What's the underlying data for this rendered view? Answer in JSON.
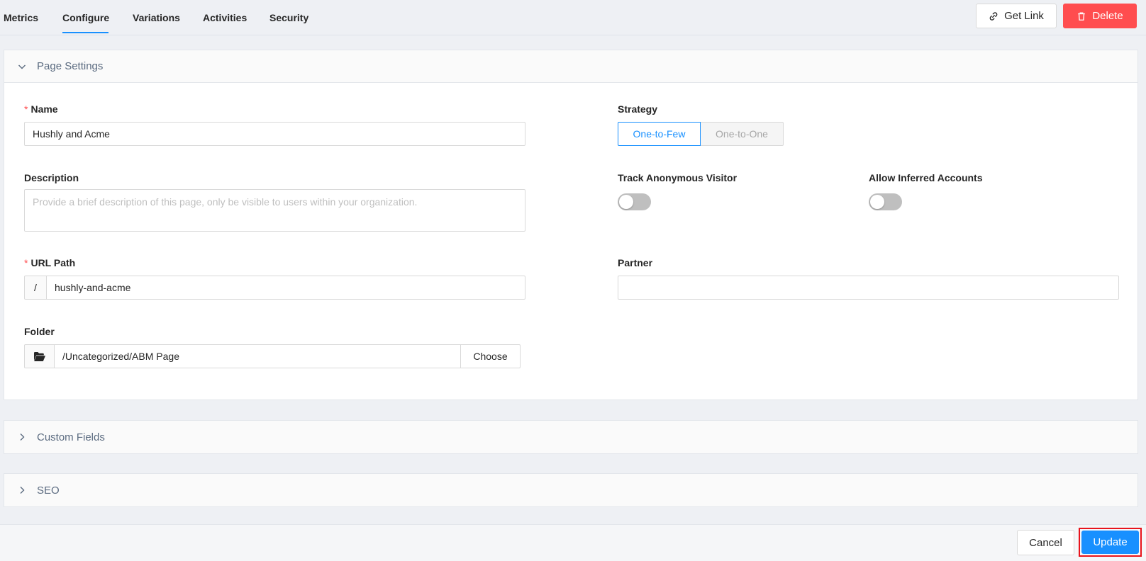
{
  "tabs": [
    {
      "label": "Metrics"
    },
    {
      "label": "Configure"
    },
    {
      "label": "Variations"
    },
    {
      "label": "Activities"
    },
    {
      "label": "Security"
    }
  ],
  "actions": {
    "get_link": "Get Link",
    "delete": "Delete"
  },
  "page_settings": {
    "title": "Page Settings",
    "name": {
      "label": "Name",
      "required_mark": "*",
      "value": "Hushly and Acme"
    },
    "description": {
      "label": "Description",
      "placeholder": "Provide a brief description of this page, only be visible to users within your organization."
    },
    "url_path": {
      "label": "URL Path",
      "required_mark": "*",
      "prefix": "/",
      "value": "hushly-and-acme"
    },
    "folder": {
      "label": "Folder",
      "value": "/Uncategorized/ABM Page",
      "choose_label": "Choose"
    },
    "strategy": {
      "label": "Strategy",
      "options": [
        "One-to-Few",
        "One-to-One"
      ],
      "selected": "One-to-Few"
    },
    "track_anonymous": {
      "label": "Track Anonymous Visitor",
      "on": false
    },
    "allow_inferred": {
      "label": "Allow Inferred Accounts",
      "on": false
    },
    "partner": {
      "label": "Partner",
      "value": ""
    }
  },
  "custom_fields": {
    "title": "Custom Fields"
  },
  "seo": {
    "title": "SEO"
  },
  "footer": {
    "cancel": "Cancel",
    "update": "Update"
  },
  "colors": {
    "primary": "#1890ff",
    "danger": "#ff4d4f",
    "highlight": "#e8141c"
  }
}
